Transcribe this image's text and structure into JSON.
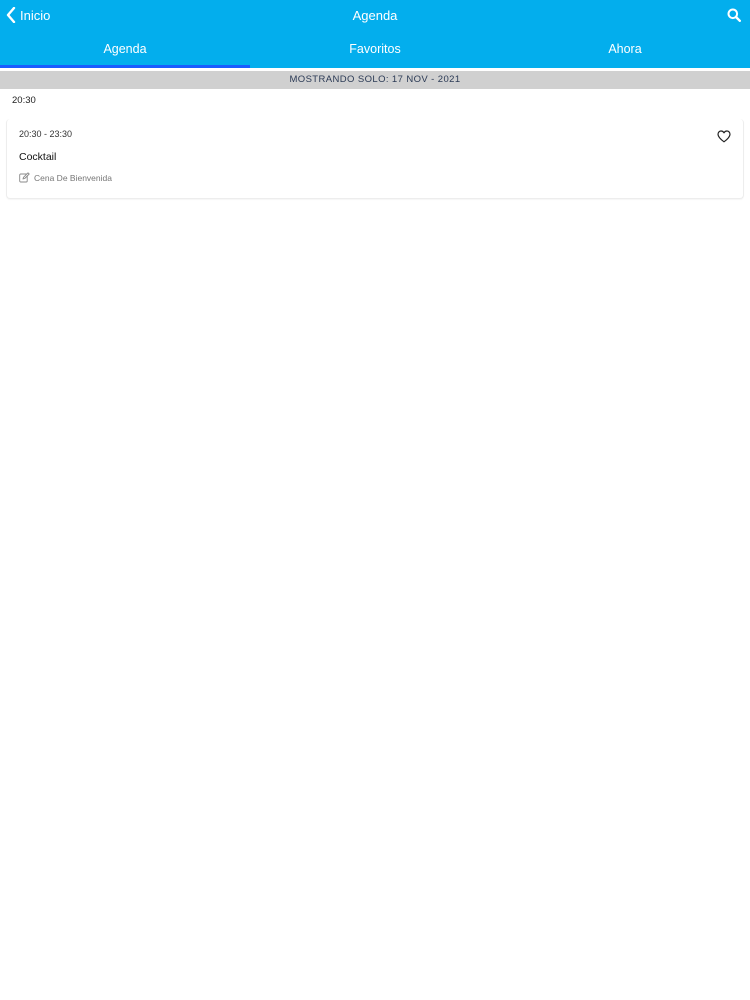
{
  "header": {
    "back_label": "Inicio",
    "title": "Agenda",
    "accent_color": "#03aeed",
    "active_tab_indicator_color": "#1a5cff"
  },
  "tabs": [
    {
      "label": "Agenda",
      "active": true
    },
    {
      "label": "Favoritos",
      "active": false
    },
    {
      "label": "Ahora",
      "active": false
    }
  ],
  "filter": {
    "text": "MOSTRANDO SOLO: 17 NOV - 2021"
  },
  "schedule": {
    "time_group": "20:30",
    "sessions": [
      {
        "time_range": "20:30 - 23:30",
        "title": "Cocktail",
        "track": "Cena De Bienvenida",
        "favorite": false
      }
    ]
  },
  "icons": {
    "back": "chevron-left-icon",
    "search": "search-icon",
    "favorite": "heart-outline-icon",
    "track": "edit-icon"
  }
}
